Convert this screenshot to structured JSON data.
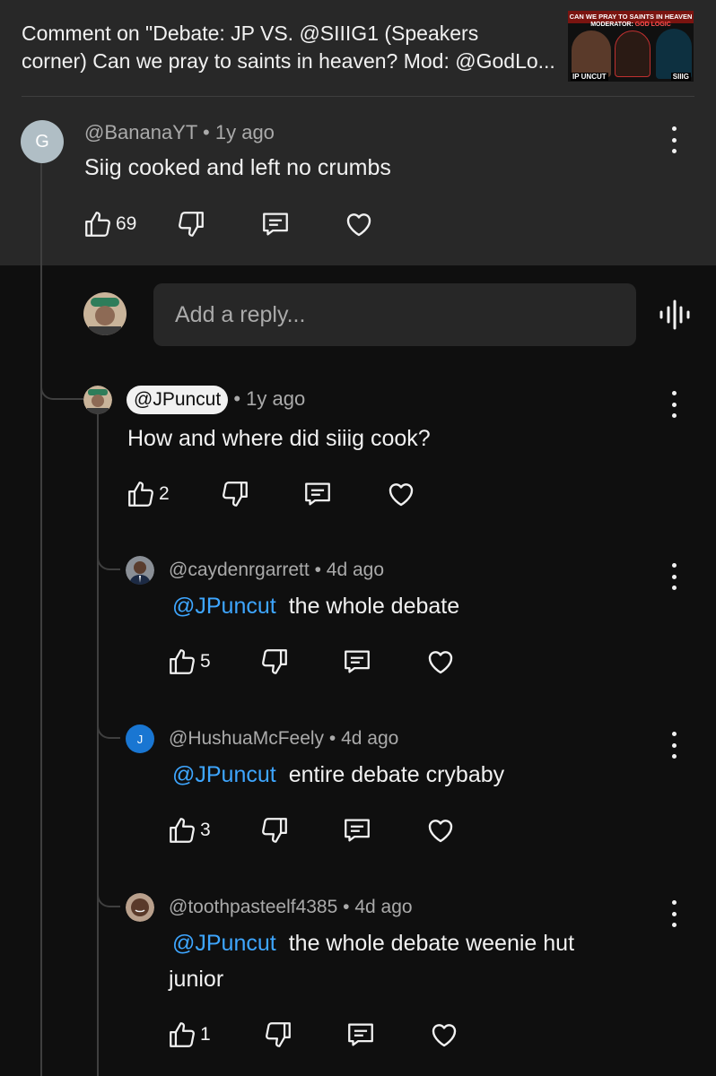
{
  "header": {
    "title_line1": "Comment on \"Debate: JP VS. @SIIIG1 (Speakers",
    "title_line2": "corner) Can we pray to saints in heaven? Mod: @GodLo...",
    "thumbnail": {
      "banner": "CAN WE PRAY TO SAINTS IN HEAVEN",
      "moderator_prefix": "MODERATOR:",
      "moderator_name": "GOD LOGIC",
      "left_label": "IP UNCUT",
      "right_label": "SIIIG"
    }
  },
  "reply_box": {
    "placeholder": "Add a reply..."
  },
  "parent_comment": {
    "avatar_letter": "G",
    "author": "@BananaYT",
    "time": "1y ago",
    "text": "Siig cooked and left no crumbs",
    "likes": "69"
  },
  "replies": [
    {
      "author": "@JPuncut",
      "time": "1y ago",
      "text": "How and where did siiig cook?",
      "likes": "2"
    },
    {
      "author": "@caydenrgarrett",
      "time": "4d ago",
      "mention": "@JPuncut",
      "text": "the whole debate",
      "likes": "5"
    },
    {
      "avatar_letter": "J",
      "author": "@HushuaMcFeely",
      "time": "4d ago",
      "mention": "@JPuncut",
      "text": "entire debate crybaby",
      "likes": "3"
    },
    {
      "author": "@toothpasteelf4385",
      "time": "4d ago",
      "mention": "@JPuncut",
      "text_line1": "the whole debate weenie hut",
      "text_line2": "junior",
      "likes": "1"
    }
  ],
  "separator": "•",
  "icons": [
    "thumbs-up-icon",
    "thumbs-down-icon",
    "reply-icon",
    "heart-icon",
    "more-vert-icon",
    "voice-input-icon"
  ],
  "colors": {
    "page_bg": "#0f0f0f",
    "header_bg": "#282828",
    "input_bg": "#272727",
    "mention": "#3ea6ff",
    "secondary_text": "#aaaaaa"
  }
}
